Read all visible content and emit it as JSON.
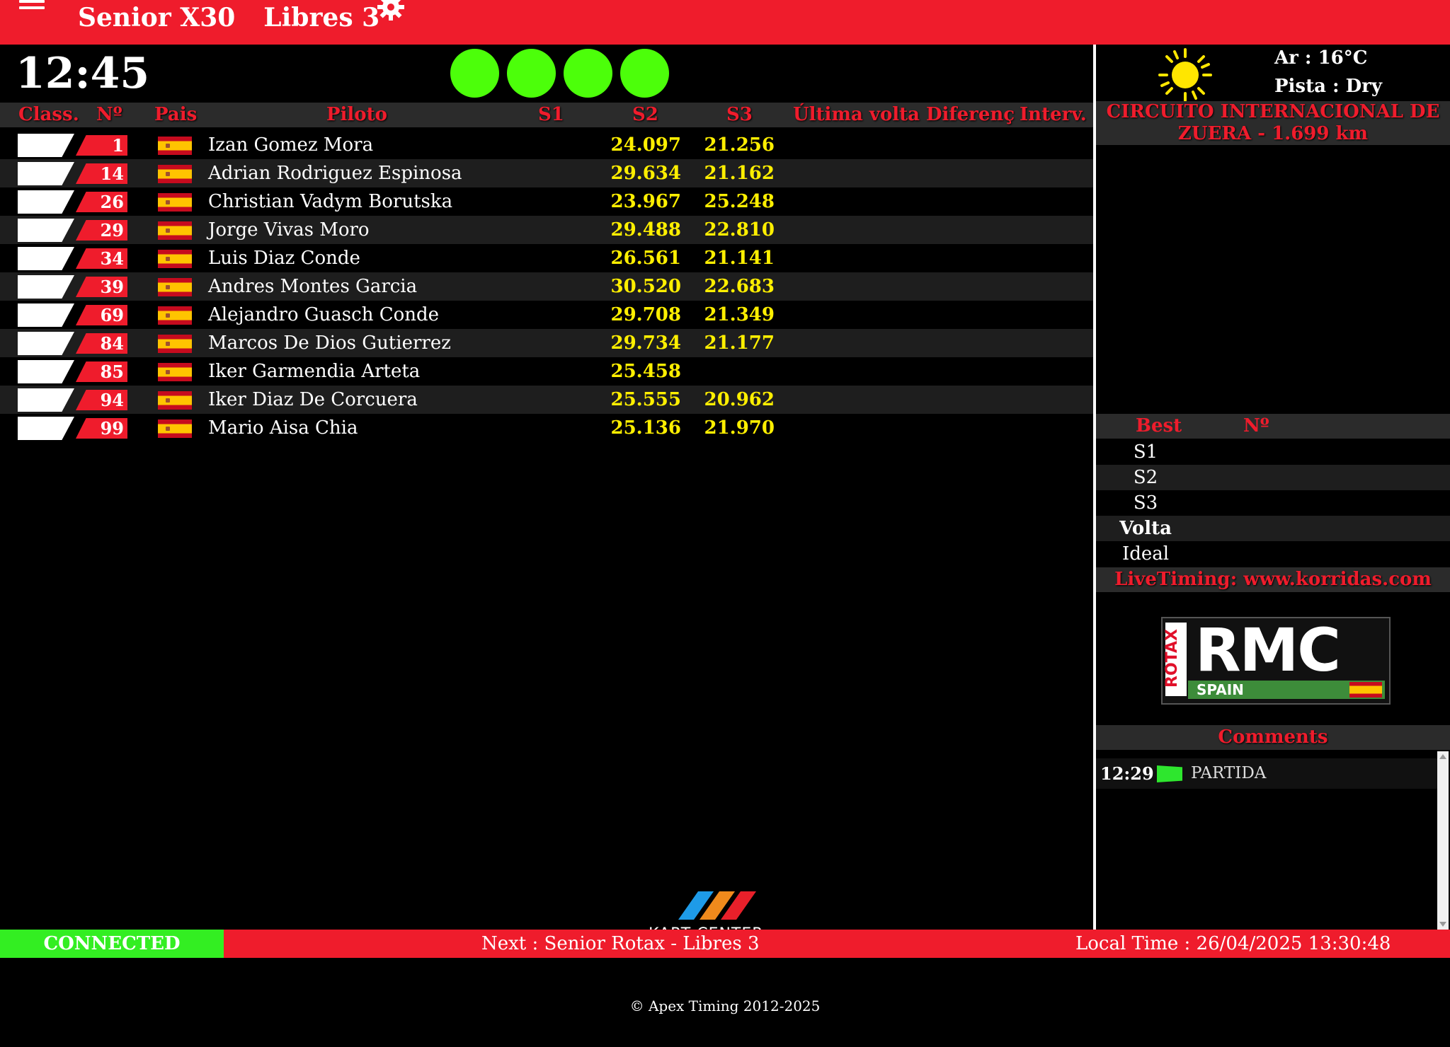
{
  "header": {
    "category": "Senior X30",
    "session": "Libres 3"
  },
  "clock": "12:45",
  "start_lights": [
    "green",
    "green",
    "green",
    "green"
  ],
  "table": {
    "columns": [
      "Class.",
      "Nº",
      "Pais",
      "Piloto",
      "S1",
      "S2",
      "S3",
      "Última volta",
      "Diferenç",
      "Interv."
    ],
    "rows": [
      {
        "num": "1",
        "driver": "Izan Gomez Mora",
        "s2": "24.097",
        "s3": "21.256"
      },
      {
        "num": "14",
        "driver": "Adrian Rodriguez Espinosa",
        "s2": "29.634",
        "s3": "21.162"
      },
      {
        "num": "26",
        "driver": "Christian Vadym Borutska",
        "s2": "23.967",
        "s3": "25.248"
      },
      {
        "num": "29",
        "driver": "Jorge Vivas Moro",
        "s2": "29.488",
        "s3": "22.810"
      },
      {
        "num": "34",
        "driver": "Luis Diaz Conde",
        "s2": "26.561",
        "s3": "21.141"
      },
      {
        "num": "39",
        "driver": "Andres Montes Garcia",
        "s2": "30.520",
        "s3": "22.683"
      },
      {
        "num": "69",
        "driver": "Alejandro Guasch Conde",
        "s2": "29.708",
        "s3": "21.349"
      },
      {
        "num": "84",
        "driver": "Marcos De Dios Gutierrez",
        "s2": "29.734",
        "s3": "21.177"
      },
      {
        "num": "85",
        "driver": "Iker Garmendia Arteta",
        "s2": "25.458",
        "s3": ""
      },
      {
        "num": "94",
        "driver": "Iker Diaz De Corcuera",
        "s2": "25.555",
        "s3": "20.962"
      },
      {
        "num": "99",
        "driver": "Mario Aisa Chia",
        "s2": "25.136",
        "s3": "21.970"
      }
    ]
  },
  "weather": {
    "icon": "sun-icon",
    "air": "Ar : 16°C",
    "track": "Pista : Dry"
  },
  "circuit": {
    "line1": "CIRCUITO INTERNACIONAL DE",
    "line2": "ZUERA - 1.699 km"
  },
  "best": {
    "header_best": "Best",
    "header_num": "Nº",
    "rows": [
      "S1",
      "S2",
      "S3",
      "Volta",
      "Ideal"
    ]
  },
  "livetiming": "LiveTiming: www.korridas.com",
  "sponsor_logo": {
    "side": "ROTAX",
    "main": "RMC",
    "sub": "SPAIN"
  },
  "comments": {
    "title": "Comments",
    "items": [
      {
        "time": "12:29",
        "icon": "green-flag-icon",
        "text": "PARTIDA"
      }
    ]
  },
  "footer": {
    "status": "CONNECTED",
    "next": "Next : Senior Rotax - Libres 3",
    "local_time": "Local Time : 26/04/2025 13:30:48",
    "brand": "KART CENTER",
    "copyright": "© Apex Timing 2012-2025"
  },
  "colors": {
    "accent_red": "#ef1c2c",
    "sector_yellow": "#ffef00",
    "light_green": "#4cff0a",
    "connected_green": "#33ee22"
  }
}
